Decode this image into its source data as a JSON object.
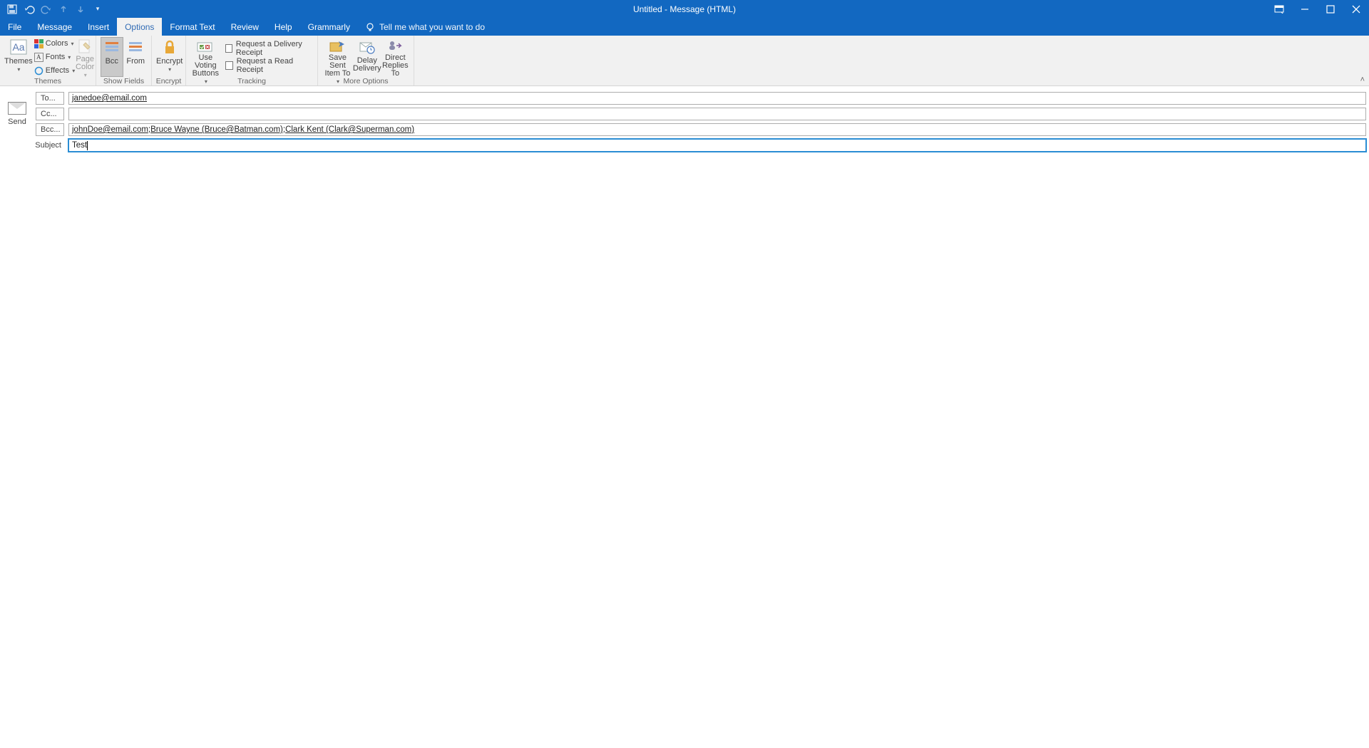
{
  "window": {
    "title": "Untitled  -  Message (HTML)"
  },
  "qat": {
    "save": "save-icon",
    "undo": "undo-icon",
    "redo": "redo-icon",
    "prev": "prev-icon",
    "next": "next-icon",
    "custom": "▾"
  },
  "tabs": {
    "items": [
      {
        "label": "File"
      },
      {
        "label": "Message"
      },
      {
        "label": "Insert"
      },
      {
        "label": "Options"
      },
      {
        "label": "Format Text"
      },
      {
        "label": "Review"
      },
      {
        "label": "Help"
      },
      {
        "label": "Grammarly"
      }
    ],
    "active_index": 3,
    "tellme": "Tell me what you want to do"
  },
  "ribbon": {
    "themes": {
      "themes_label": "Themes",
      "colors": "Colors",
      "fonts": "Fonts",
      "effects": "Effects",
      "page_color": "Page Color",
      "group": "Themes"
    },
    "show_fields": {
      "bcc": "Bcc",
      "from": "From",
      "group": "Show Fields"
    },
    "encrypt": {
      "label": "Encrypt",
      "group": "Encrypt"
    },
    "tracking": {
      "voting": "Use Voting Buttons",
      "delivery": "Request a Delivery Receipt",
      "read": "Request a Read Receipt",
      "group": "Tracking"
    },
    "more": {
      "save_sent": "Save Sent Item To",
      "delay": "Delay Delivery",
      "direct": "Direct Replies To",
      "group": "More Options"
    }
  },
  "address": {
    "send": "Send",
    "to_label": "To...",
    "cc_label": "Cc...",
    "bcc_label": "Bcc...",
    "subject_label": "Subject",
    "to": "janedoe@email.com",
    "cc": "",
    "bcc_parts": [
      "johnDoe@email.com",
      "; ",
      "Bruce Wayne (Bruce@Batman.com)",
      "; ",
      "Clark Kent (Clark@Superman.com)"
    ],
    "subject": "Test"
  }
}
